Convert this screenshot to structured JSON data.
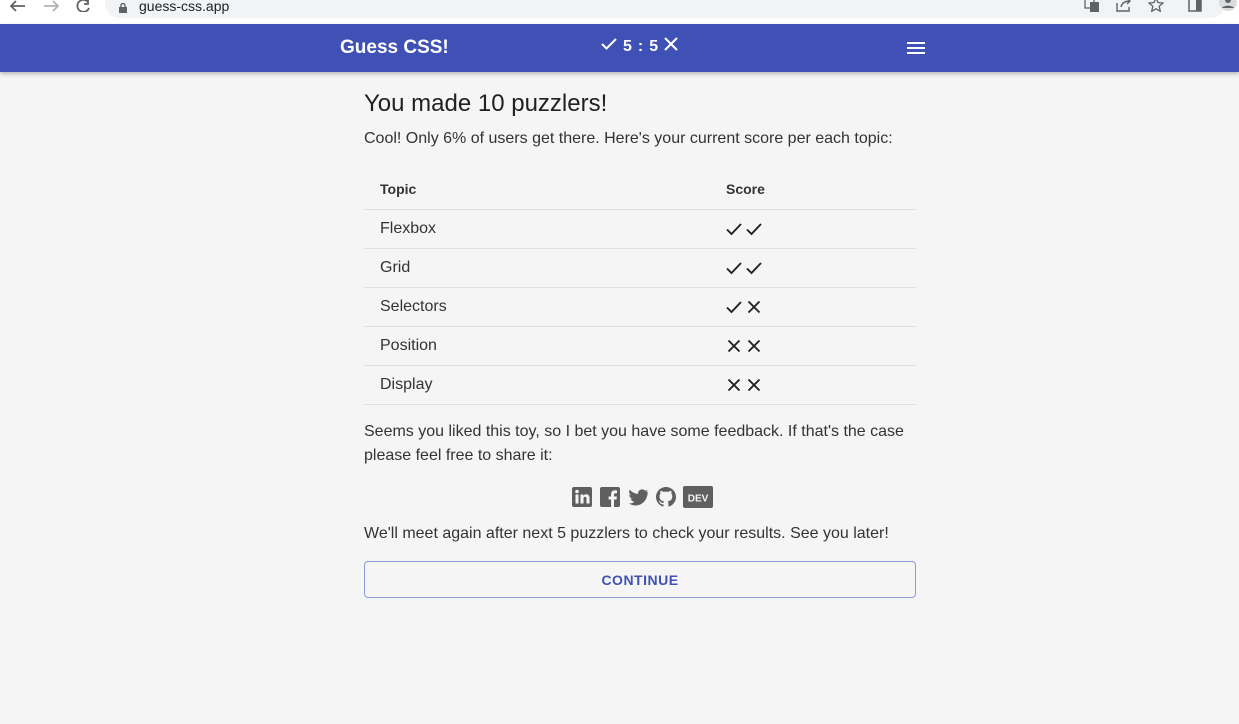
{
  "browser": {
    "url": "guess-css.app"
  },
  "header": {
    "title": "Guess CSS!",
    "score_correct": "5",
    "score_separator": ":",
    "score_wrong": "5"
  },
  "main": {
    "heading": "You made 10 puzzlers!",
    "intro": "Cool! Only 6% of users get there. Here's your current score per each topic:",
    "table": {
      "columns": [
        "Topic",
        "Score"
      ],
      "rows": [
        {
          "topic": "Flexbox",
          "score": [
            "check",
            "check"
          ]
        },
        {
          "topic": "Grid",
          "score": [
            "check",
            "check"
          ]
        },
        {
          "topic": "Selectors",
          "score": [
            "check",
            "cross"
          ]
        },
        {
          "topic": "Position",
          "score": [
            "cross",
            "cross"
          ]
        },
        {
          "topic": "Display",
          "score": [
            "cross",
            "cross"
          ]
        }
      ]
    },
    "feedback": "Seems you liked this toy, so I bet you have some feedback. If that's the case please feel free to share it:",
    "social_icons": [
      "linkedin-icon",
      "facebook-icon",
      "twitter-icon",
      "github-icon",
      "dev-icon"
    ],
    "dev_label": "DEV",
    "outro": "We'll meet again after next 5 puzzlers to check your results. See you later!",
    "continue_label": "CONTINUE"
  },
  "colors": {
    "header_bg": "#3f51b5",
    "page_bg": "#f5f5f5",
    "accent": "#3f51b5"
  }
}
